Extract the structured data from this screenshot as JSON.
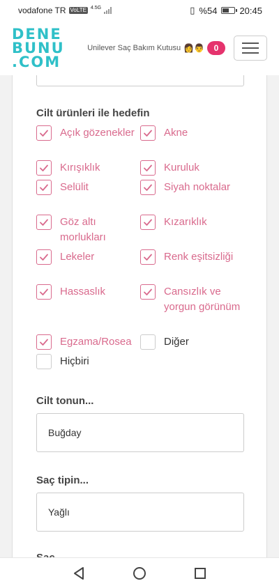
{
  "statusbar": {
    "carrier": "vodafone TR",
    "volte": "VoLTE",
    "network": "4.5G",
    "battery_text": "%54",
    "battery_level": 0.54,
    "time": "20:45"
  },
  "header": {
    "logo_line1": "DENE",
    "logo_line2": "BUNU",
    "logo_line3": ".COM",
    "promo_text": "Unilever Saç Bakım Kutusu",
    "promo_emoji": "👩👨",
    "cart_count": "0"
  },
  "skin_goals": {
    "label": "Cilt ürünleri ile hedefin",
    "options": [
      {
        "label": "Açık gözenekler",
        "checked": true
      },
      {
        "label": "Akne",
        "checked": true
      },
      {
        "label": "Kırışıklık",
        "checked": true
      },
      {
        "label": "Kuruluk",
        "checked": true
      },
      {
        "label": "Selülit",
        "checked": true
      },
      {
        "label": "Siyah noktalar",
        "checked": true
      },
      {
        "label": "Göz altı morlukları",
        "checked": true
      },
      {
        "label": "Kızarıklık",
        "checked": true
      },
      {
        "label": "Lekeler",
        "checked": true
      },
      {
        "label": "Renk eşitsizliği",
        "checked": true
      },
      {
        "label": "Hassaslık",
        "checked": true
      },
      {
        "label": "Cansızlık ve yorgun görünüm",
        "checked": true
      },
      {
        "label": "Egzama/Rosea",
        "checked": true
      },
      {
        "label": "Diğer",
        "checked": false
      },
      {
        "label": "Hiçbiri",
        "checked": false
      }
    ]
  },
  "skin_tone": {
    "label": "Cilt tonun...",
    "value": "Buğday"
  },
  "hair_type": {
    "label": "Saç tipin...",
    "value": "Yağlı"
  },
  "next_section": {
    "label": "Saç..."
  },
  "colors": {
    "accent": "#d96a8d",
    "logo": "#2fc0c8",
    "badge": "#e5336d"
  }
}
